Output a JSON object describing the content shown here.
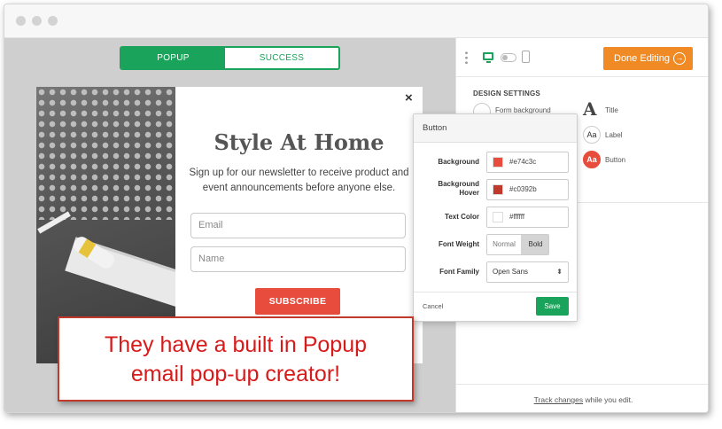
{
  "tabs": {
    "popup": "POPUP",
    "success": "SUCCESS"
  },
  "popup": {
    "close": "×",
    "title": "Style At Home",
    "subtitle": "Sign up for our newsletter to receive product and event announcements before anyone else.",
    "email_placeholder": "Email",
    "name_placeholder": "Name",
    "subscribe_label": "SUBSCRIBE"
  },
  "toolbar": {
    "done_label": "Done Editing",
    "done_icon": "→"
  },
  "design": {
    "title": "DESIGN SETTINGS",
    "form_background": "Form background",
    "title_opt": "Title",
    "title_glyph": "A",
    "label_opt": "Label",
    "label_glyph": "Aa",
    "button_opt": "Button",
    "button_glyph": "Aa"
  },
  "button_panel": {
    "header": "Button",
    "background_label": "Background",
    "background_value": "#e74c3c",
    "hover_label": "Background Hover",
    "hover_value": "#c0392b",
    "text_color_label": "Text Color",
    "text_color_value": "#ffffff",
    "font_weight_label": "Font Weight",
    "weight_normal": "Normal",
    "weight_bold": "Bold",
    "font_family_label": "Font Family",
    "font_family_value": "Open Sans",
    "select_arrow": "⬍",
    "cancel_label": "Cancel",
    "save_label": "Save"
  },
  "footer": {
    "track_link": "Track changes",
    "track_rest": " while you edit."
  },
  "callout": {
    "line1": "They have a built in Popup",
    "line2": "email pop-up creator!"
  },
  "colors": {
    "accent_green": "#1aa35a",
    "done_orange": "#f08a24",
    "subscribe_red": "#e74c3c",
    "hover_red": "#c0392b",
    "callout_red": "#d71a1a"
  }
}
